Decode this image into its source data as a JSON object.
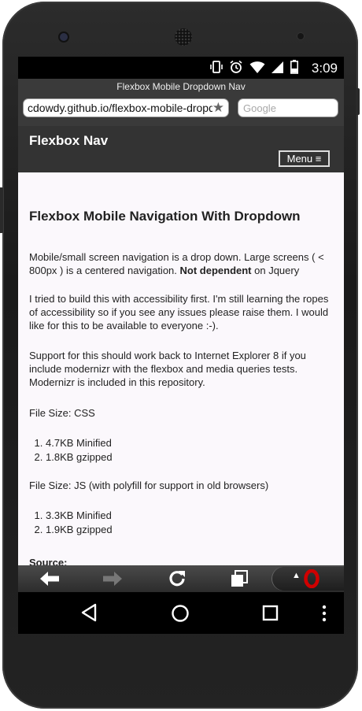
{
  "status_bar": {
    "time": "3:09",
    "icons": [
      "vibrate-icon",
      "alarm-icon",
      "wifi-icon",
      "signal-icon",
      "battery-icon"
    ]
  },
  "browser": {
    "page_title": "Flexbox Mobile Dropdown Nav",
    "url": "cdowdy.github.io/flexbox-mobile-dropdown-nav",
    "search_placeholder": "Google",
    "toolbar_icons": [
      "back-icon",
      "forward-icon",
      "reload-icon",
      "tabs-icon",
      "opera-menu-icon"
    ]
  },
  "site": {
    "brand": "Flexbox Nav",
    "menu_label": "Menu",
    "heading": "Flexbox Mobile Navigation With Dropdown",
    "intro_pre": "Mobile/small screen navigation is a drop down. Large screens ( < 800px ) is a centered navigation. ",
    "intro_bold": "Not dependent",
    "intro_post": " on Jquery",
    "accessibility": "I tried to build this with accessibility first. I'm  still learning the ropes of accessibility so if you see any issues please raise them. I would like for this to be available to everyone :-).",
    "support": "Support for this should work back to Internet Explorer 8 if you include modernizr with the flexbox and media queries tests. Modernizr is included in this repository.",
    "css_size_label": "File Size: CSS",
    "css_sizes": [
      "4.7KB Minified",
      "1.8KB gzipped"
    ],
    "js_size_label": "File Size: JS (with polyfill for support in old browsers)",
    "js_sizes": [
      "3.3KB Minified",
      "1.9KB gzipped"
    ],
    "source_label": "Source:"
  },
  "android_nav": [
    "back-triangle-icon",
    "home-circle-icon",
    "recents-square-icon",
    "overflow-menu-icon"
  ],
  "colors": {
    "site_nav": "#333333",
    "content_bg": "#fbf8fc",
    "opera_red": "#d00000"
  }
}
